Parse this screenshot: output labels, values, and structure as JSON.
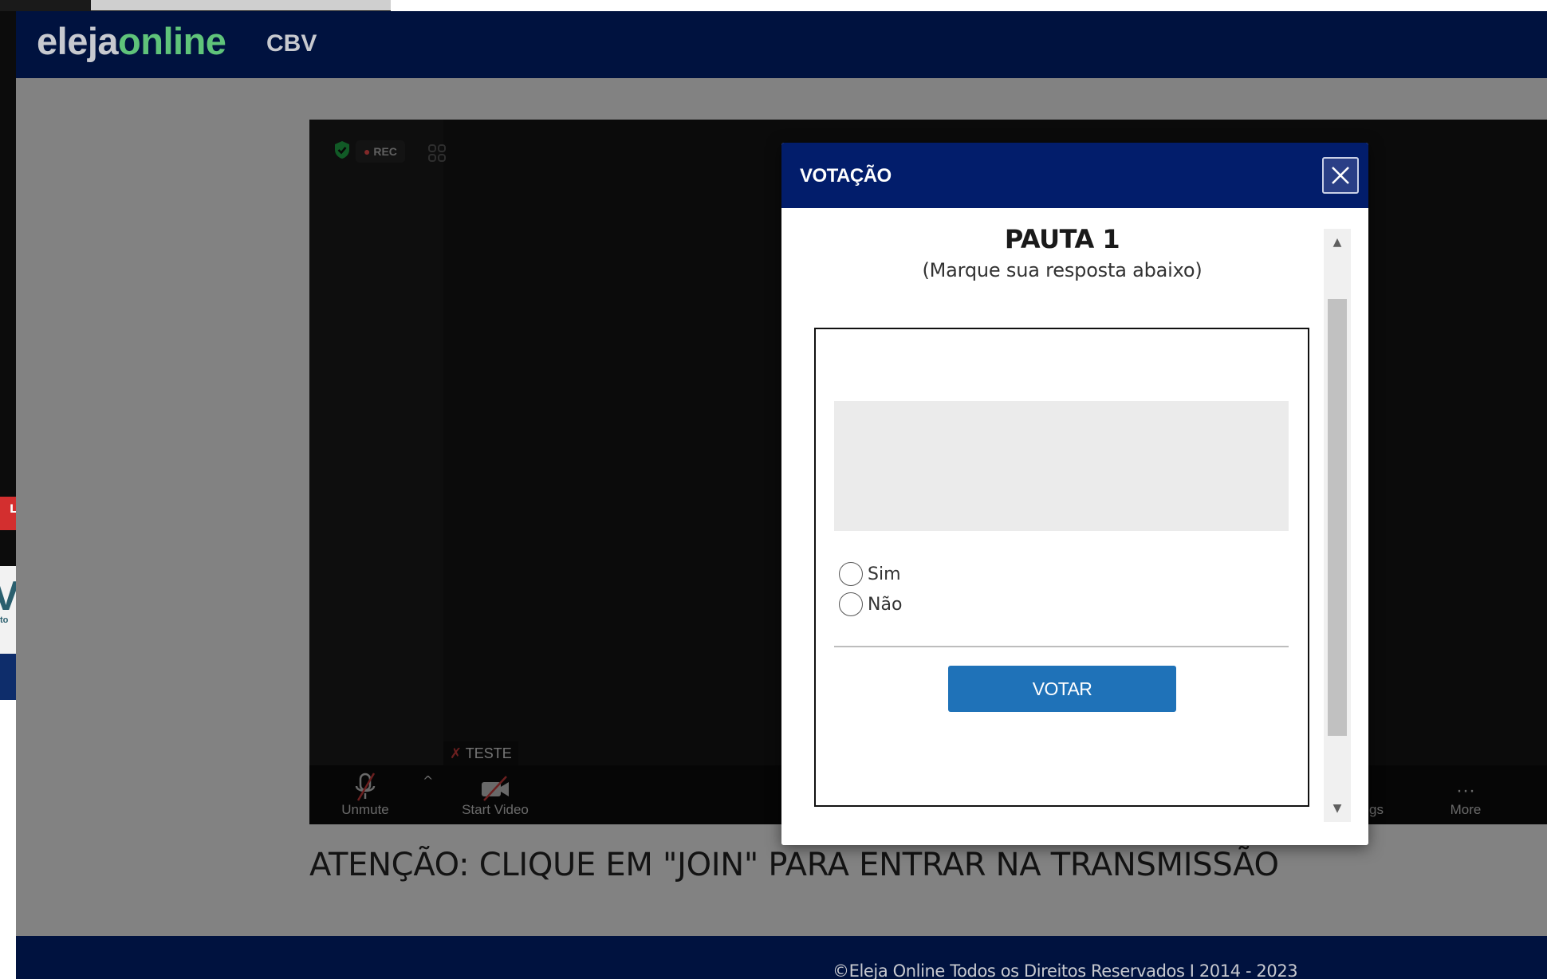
{
  "bg_window": {
    "red_tab_letter": "L",
    "logo_letter": "V",
    "logo_sub": "to"
  },
  "header": {
    "logo_part1": "eleja",
    "logo_part2": "online",
    "logo_suffix": "CBV"
  },
  "meeting": {
    "rec_label": "REC",
    "rec_dot": "●",
    "participant_name": "TESTE",
    "toolbar": {
      "unmute_label": "Unmute",
      "caret": "^",
      "start_video_label": "Start Video",
      "settings_label_partial": "gs",
      "more_label": "More",
      "more_glyph": "···"
    }
  },
  "attention_text": "ATENÇÃO: CLIQUE EM \"JOIN\" PARA ENTRAR NA TRANSMISSÃO",
  "footer_text": "©Eleja Online Todos os Direitos Reservados  I  2014 - 2023",
  "modal": {
    "title": "VOTAÇÃO",
    "pauta_title": "PAUTA 1",
    "pauta_subtitle": "(Marque sua resposta abaixo)",
    "options": [
      "Sim",
      "Não"
    ],
    "vote_button": "VOTAR",
    "scroll_up": "▲",
    "scroll_down": "▼"
  },
  "colors": {
    "header_bg": "#00123f",
    "modal_header": "#021d6b",
    "vote_button": "#1f72b8",
    "logo_green": "#5fc37a"
  }
}
